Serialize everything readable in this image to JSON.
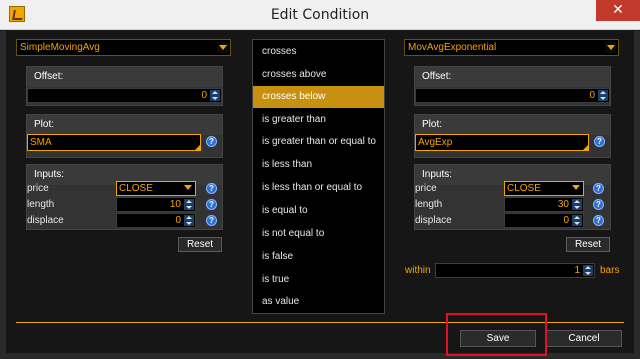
{
  "window": {
    "title": "Edit Condition",
    "close_glyph": "✕"
  },
  "left": {
    "indicator": "SimpleMovingAvg",
    "offset_label": "Offset:",
    "offset_value": "0",
    "plot_label": "Plot:",
    "plot_value": "SMA",
    "inputs_label": "Inputs:",
    "inputs": [
      {
        "name": "price",
        "value": "CLOSE"
      },
      {
        "name": "length",
        "value": "10"
      },
      {
        "name": "displace",
        "value": "0"
      }
    ],
    "reset_label": "Reset"
  },
  "conditions": {
    "items": [
      "crosses",
      "crosses above",
      "crosses below",
      "is greater than",
      "is greater than or equal to",
      "is less than",
      "is less than or equal to",
      "is equal to",
      "is not equal to",
      "is false",
      "is true",
      "as value"
    ],
    "selected": "crosses below"
  },
  "right": {
    "indicator": "MovAvgExponential",
    "offset_label": "Offset:",
    "offset_value": "0",
    "plot_label": "Plot:",
    "plot_value": "AvgExp",
    "inputs_label": "Inputs:",
    "inputs": [
      {
        "name": "price",
        "value": "CLOSE"
      },
      {
        "name": "length",
        "value": "30"
      },
      {
        "name": "displace",
        "value": "0"
      }
    ],
    "reset_label": "Reset",
    "within_label": "within",
    "within_value": "1",
    "bars_label": "bars"
  },
  "footer": {
    "save_label": "Save",
    "cancel_label": "Cancel"
  },
  "colors": {
    "accent": "#f2a400",
    "selected_bg": "#c89011",
    "highlight": "#e0102a",
    "help_icon": "#2d6fd6"
  },
  "icons": {
    "help": "?"
  }
}
